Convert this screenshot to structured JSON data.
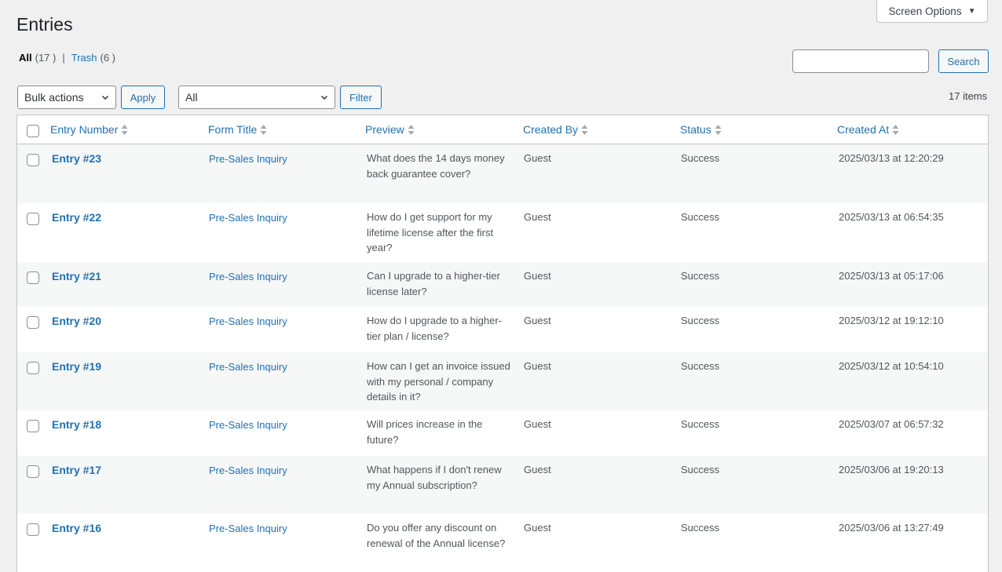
{
  "screen_options": {
    "label": "Screen Options",
    "caret": "▼"
  },
  "page": {
    "title": "Entries"
  },
  "views": {
    "all_label": "All",
    "all_count": "(17 )",
    "separator": "|",
    "trash_label": "Trash",
    "trash_count": "(6 )"
  },
  "search": {
    "button": "Search",
    "value": ""
  },
  "toolbar": {
    "bulk_actions": "Bulk actions",
    "apply": "Apply",
    "form_filter": "All",
    "filter": "Filter",
    "items_count": "17 items"
  },
  "columns": [
    "Entry Number",
    "Form Title",
    "Preview",
    "Created By",
    "Status",
    "Created At"
  ],
  "rows": [
    {
      "entry": "Entry #23",
      "form": "Pre-Sales Inquiry",
      "preview": "What does the 14 days money back guarantee cover?",
      "created_by": "Guest",
      "status": "Success",
      "created_at": "2025/03/13 at 12:20:29"
    },
    {
      "entry": "Entry #22",
      "form": "Pre-Sales Inquiry",
      "preview": "How do I get support for my lifetime license after the first year?",
      "created_by": "Guest",
      "status": "Success",
      "created_at": "2025/03/13 at 06:54:35"
    },
    {
      "entry": "Entry #21",
      "form": "Pre-Sales Inquiry",
      "preview": "Can I upgrade to a higher-tier license later?",
      "created_by": "Guest",
      "status": "Success",
      "created_at": "2025/03/13 at 05:17:06"
    },
    {
      "entry": "Entry #20",
      "form": "Pre-Sales Inquiry",
      "preview": "How do I upgrade to a higher-tier plan / license?",
      "created_by": "Guest",
      "status": "Success",
      "created_at": "2025/03/12 at 19:12:10"
    },
    {
      "entry": "Entry #19",
      "form": "Pre-Sales Inquiry",
      "preview": "How can I get an invoice issued with my personal / company details in it?",
      "created_by": "Guest",
      "status": "Success",
      "created_at": "2025/03/12 at 10:54:10"
    },
    {
      "entry": "Entry #18",
      "form": "Pre-Sales Inquiry",
      "preview": "Will prices increase in the future?",
      "created_by": "Guest",
      "status": "Success",
      "created_at": "2025/03/07 at 06:57:32"
    },
    {
      "entry": "Entry #17",
      "form": "Pre-Sales Inquiry",
      "preview": "What happens if I don't renew my Annual subscription?",
      "created_by": "Guest",
      "status": "Success",
      "created_at": "2025/03/06 at 19:20:13"
    },
    {
      "entry": "Entry #16",
      "form": "Pre-Sales Inquiry",
      "preview": "Do you offer any discount on renewal of the Annual license?",
      "created_by": "Guest",
      "status": "Success",
      "created_at": "2025/03/06 at 13:27:49"
    }
  ],
  "colors": {
    "link": "#2271b1",
    "row_alt": "#f6f7f7",
    "background": "#f0f0f1"
  },
  "icons": {
    "sort": "sort-arrows-icon",
    "dropdown": "chevron-down-icon",
    "screen_options": "caret-down-icon"
  }
}
